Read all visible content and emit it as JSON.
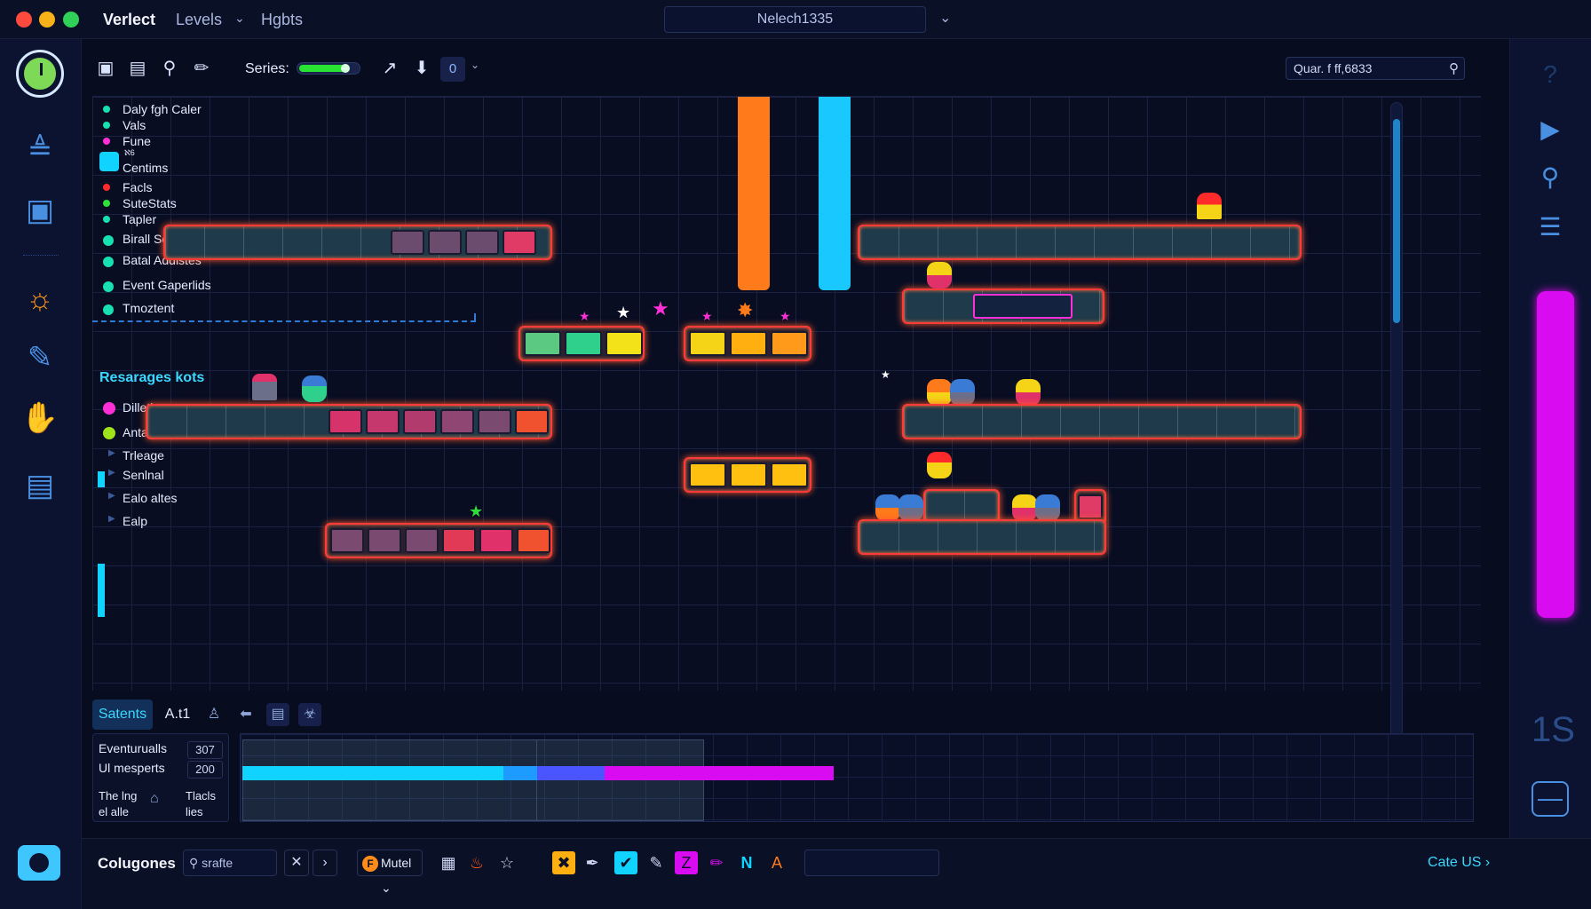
{
  "window": {
    "app_title": "Verlect",
    "menu_levels": "Levels",
    "menu_hgbts": "Hgbts",
    "title_field": "Nelech1335"
  },
  "toolbar": {
    "series_label": "Series:",
    "series_level": 0.8,
    "zero_label": "0",
    "search_value": "Quar. f ff,6833"
  },
  "legend": {
    "items": [
      {
        "label": "Daly fgh Caler",
        "color": "#19e0b0"
      },
      {
        "label": "Vals",
        "color": "#19e0b0"
      },
      {
        "label": "Fune",
        "color": "#ff2fd6"
      },
      {
        "label": "Centims",
        "sub": "ℵ6",
        "color": "#11d3ff"
      },
      {
        "label": "Facls",
        "color": "#ff2b2b"
      },
      {
        "label": "SuteStats",
        "color": "#2fe03a"
      },
      {
        "label": "Tapler",
        "color": "#19e0b0"
      },
      {
        "label": "Birall Secoms",
        "color": "#19e0b0"
      },
      {
        "label": "Batal Addistes",
        "color": "#19e0b0"
      },
      {
        "label": "Event Gaperlids",
        "color": "#19e0b0"
      },
      {
        "label": "Tmoztent",
        "color": "#19e0b0"
      }
    ],
    "section_title": "Resarages kots",
    "section_items": [
      {
        "label": "Dilletipes",
        "color": "#ff2fd6"
      },
      {
        "label": "Antafeness",
        "color": "#a0e31a"
      },
      {
        "label": "Trleage"
      },
      {
        "label": "Senlnal"
      },
      {
        "label": "Ealo altes"
      },
      {
        "label": "Ealp"
      }
    ]
  },
  "bottom_panel": {
    "tab_active": "Satents",
    "tab_2": "A.t1",
    "stats": [
      {
        "label": "Eventurualls",
        "value": "307"
      },
      {
        "label": "Ul mesperts",
        "value": "200"
      }
    ],
    "footnote_1a": "The lng",
    "footnote_1b": "el alle",
    "footnote_2a": "Tlacls",
    "footnote_2b": "lies"
  },
  "footer": {
    "title": "Colugones",
    "search_value": "srafte",
    "mutel_label": "Mutel",
    "link": "Cate US"
  },
  "right_sidebar": {
    "text": "1S"
  },
  "colors": {
    "accent_cyan": "#3ad8ff",
    "platform_glow": "#ff3a3a",
    "magenta": "#d90bf0",
    "orange_pillar": "#ff7a1a",
    "cyan_pillar": "#18c8ff"
  }
}
